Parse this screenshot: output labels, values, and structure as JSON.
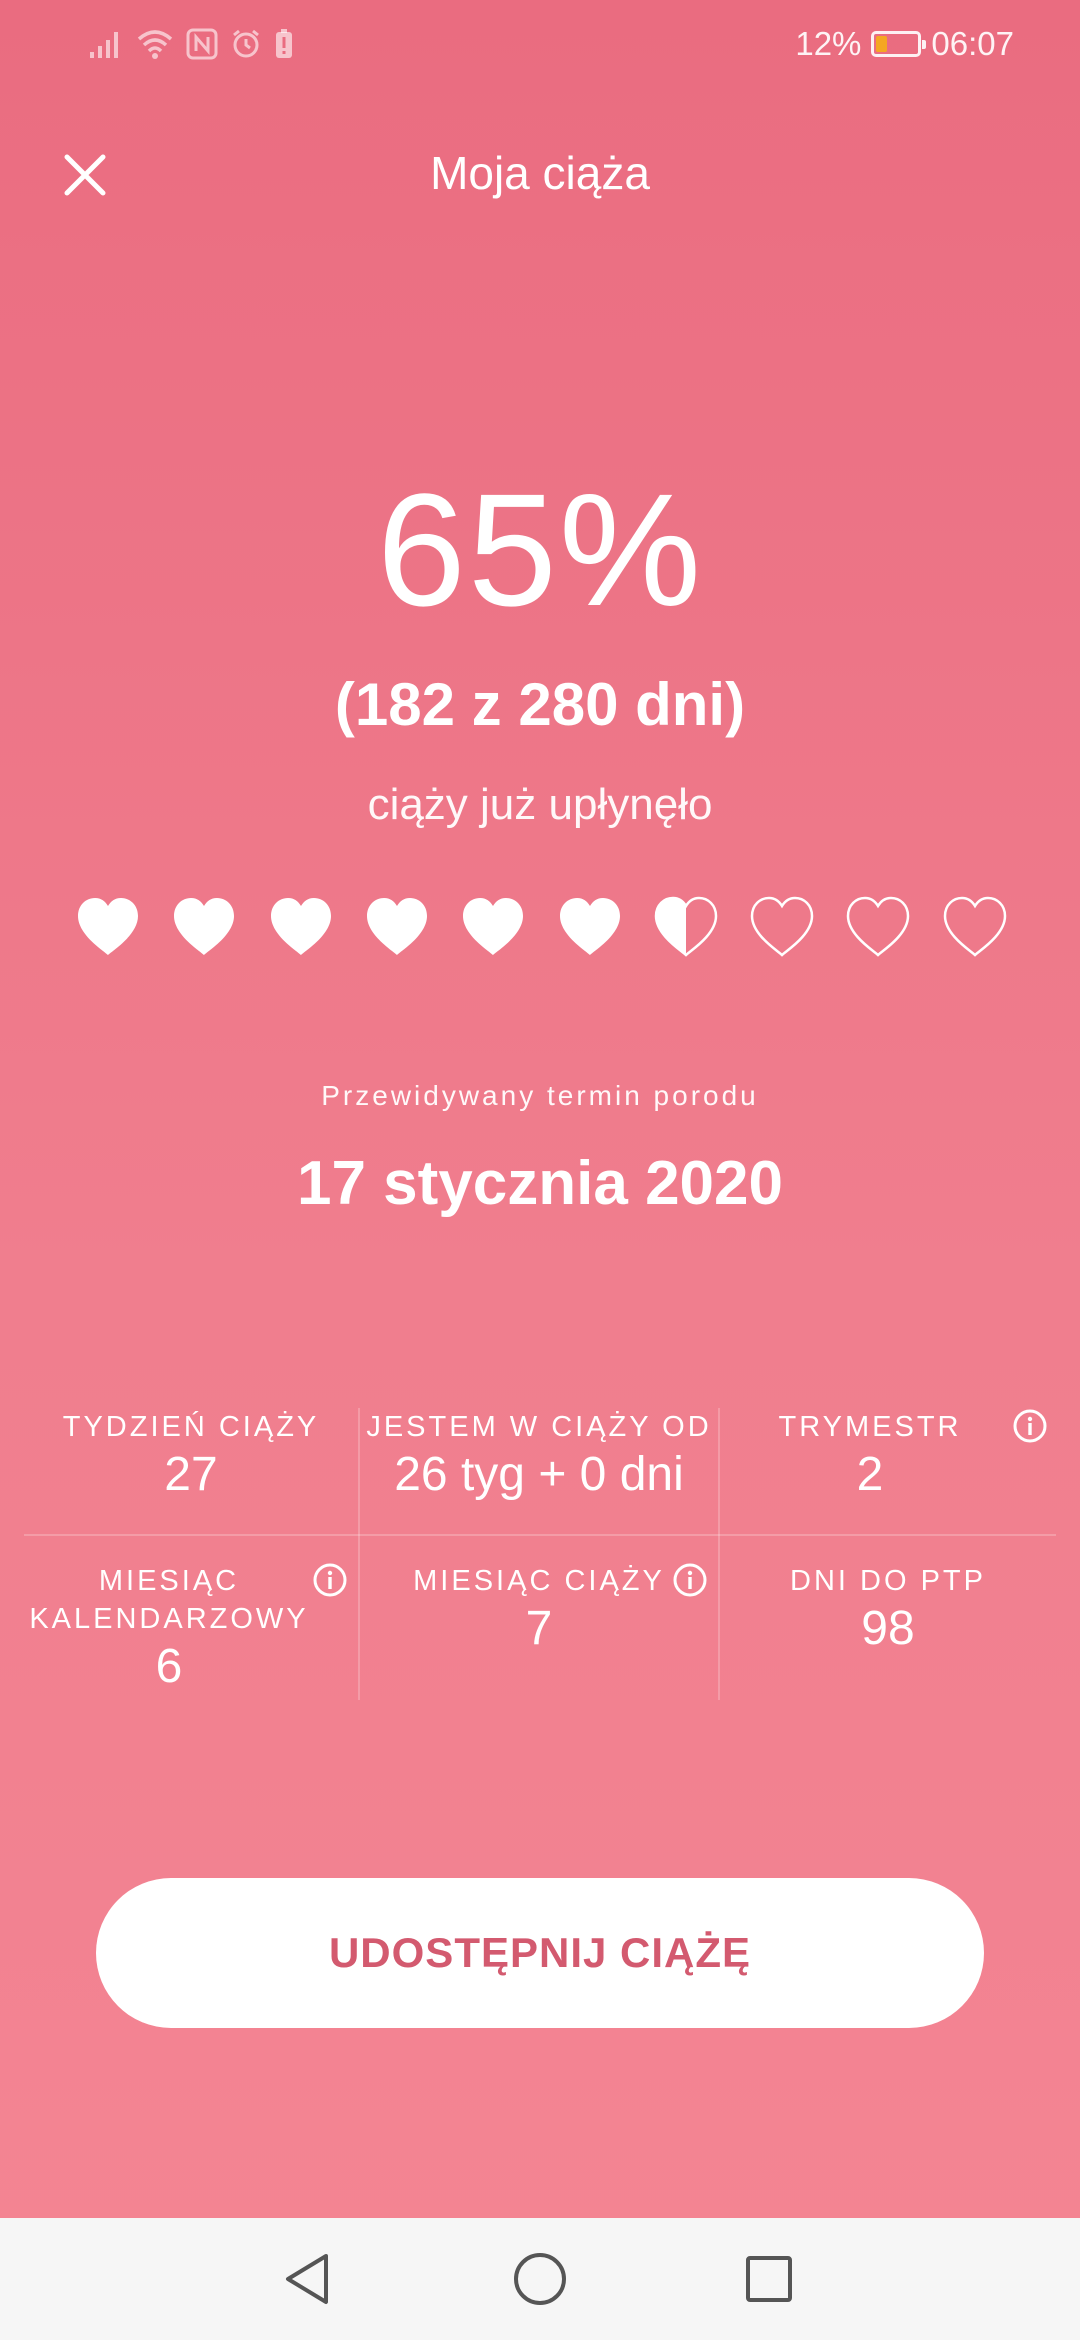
{
  "status_bar": {
    "battery_percent": "12%",
    "battery_level": 0.12,
    "time": "06:07",
    "icons": [
      "signal-icon",
      "wifi-icon",
      "nfc-icon",
      "alarm-icon",
      "battery-alert-icon"
    ]
  },
  "header": {
    "title": "Moja ciąża",
    "close_icon": "close-icon"
  },
  "progress": {
    "percent": "65%",
    "days": "(182 z 280 dni)",
    "subtitle": "ciąży już upłynęło",
    "hearts": [
      "full",
      "full",
      "full",
      "full",
      "full",
      "full",
      "half",
      "empty",
      "empty",
      "empty"
    ]
  },
  "due": {
    "label": "Przewidywany termin porodu",
    "date": "17 stycznia 2020"
  },
  "stats": {
    "pregnancy_week": {
      "label": "TYDZIEŃ CIĄŻY",
      "value": "27"
    },
    "pregnant_since": {
      "label": "JESTEM W CIĄŻY OD",
      "value": "26 tyg + 0 dni"
    },
    "trimester": {
      "label": "TRYMESTR",
      "value": "2"
    },
    "calendar_month": {
      "label_line1": "MIESIĄC",
      "label_line2": "KALENDARZOWY",
      "value": "6"
    },
    "pregnancy_month": {
      "label": "MIESIĄC CIĄŻY",
      "value": "7"
    },
    "days_to_due": {
      "label": "DNI DO PTP",
      "value": "98"
    }
  },
  "share_button": {
    "label": "UDOSTĘPNIJ CIĄŻĘ"
  },
  "colors": {
    "background_top": "#ea6c80",
    "background_bottom": "#f48593",
    "accent_text": "#d35a6f",
    "battery_fill": "#f5a623"
  },
  "nav_bar": {
    "icons": [
      "back-icon",
      "home-icon",
      "recents-icon"
    ]
  }
}
